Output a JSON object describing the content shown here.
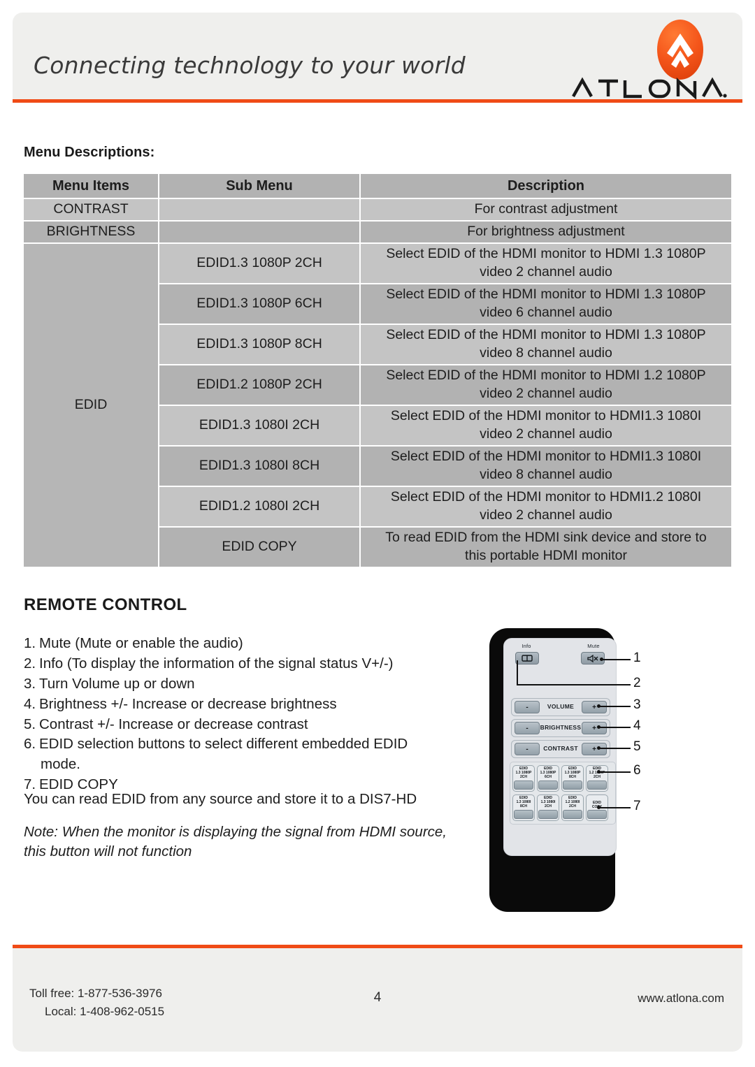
{
  "header": {
    "tagline": "Connecting technology to your world",
    "brand": "ATLONA",
    "brand_mark": "atlona-logo-icon"
  },
  "colors": {
    "accent_orange": "#f04b16",
    "panel_grey": "#efefed",
    "table_header_grey": "#b2b2b2",
    "table_row_light": "#c4c4c4",
    "table_row_dark": "#b2b2b2"
  },
  "main": {
    "section_title": "Menu Descriptions:",
    "table": {
      "headers": [
        "Menu Items",
        "Sub Menu",
        "Description"
      ],
      "rows": [
        {
          "item": "CONTRAST",
          "sub": "",
          "desc_line1": "For contrast adjustment",
          "desc_line2": ""
        },
        {
          "item": "BRIGHTNESS",
          "sub": "",
          "desc_line1": "For brightness adjustment",
          "desc_line2": ""
        }
      ],
      "edid_group_label": "EDID",
      "edid_rows": [
        {
          "sub": "EDID1.3 1080P 2CH",
          "desc_line1": "Select EDID of the HDMI monitor to HDMI 1.3 1080P",
          "desc_line2": "video 2 channel audio"
        },
        {
          "sub": "EDID1.3 1080P 6CH",
          "desc_line1": "Select EDID of the HDMI monitor to HDMI 1.3 1080P",
          "desc_line2": "video 6 channel audio"
        },
        {
          "sub": "EDID1.3 1080P 8CH",
          "desc_line1": "Select EDID of the HDMI monitor to HDMI 1.3 1080P",
          "desc_line2": "video 8 channel audio"
        },
        {
          "sub": "EDID1.2 1080P 2CH",
          "desc_line1": "Select EDID of the HDMI monitor to  HDMI 1.2 1080P",
          "desc_line2": "video 2 channel audio"
        },
        {
          "sub": "EDID1.3 1080I 2CH",
          "desc_line1": "Select EDID of the HDMI monitor to HDMI1.3 1080I",
          "desc_line2": "video 2 channel audio"
        },
        {
          "sub": "EDID1.3 1080I 8CH",
          "desc_line1": "Select EDID of the HDMI monitor to HDMI1.3 1080I",
          "desc_line2": "video 8 channel audio"
        },
        {
          "sub": "EDID1.2 1080I 2CH",
          "desc_line1": "Select EDID of the HDMI monitor to  HDMI1.2 1080I",
          "desc_line2": "video 2 channel audio"
        },
        {
          "sub": "EDID COPY",
          "desc_line1": "To read EDID from the HDMI sink device and store to",
          "desc_line2": "this portable HDMI monitor"
        }
      ]
    },
    "remote": {
      "heading": "REMOTE CONTROL",
      "steps": [
        {
          "num": "1.",
          "text": "Mute (Mute or enable the audio)"
        },
        {
          "num": "2.",
          "text": "Info (To display the information of the signal status V+/-)"
        },
        {
          "num": "3.",
          "text": "Turn Volume up or down"
        },
        {
          "num": "4.",
          "text": "Brightness +/-  Increase or decrease brightness"
        },
        {
          "num": "5.",
          "text": "Contrast +/- Increase or decrease contrast"
        },
        {
          "num": "6.",
          "text": "EDID selection buttons to select different embedded EDID",
          "cont": "mode."
        },
        {
          "num": "7.",
          "text": "EDID COPY"
        }
      ],
      "paragraph": "You can read EDID from any source and store it to a DIS7-HD",
      "note": "Note: When the monitor is displaying the signal from HDMI source, this button will not function"
    },
    "remote_art": {
      "info_label": "Info",
      "mute_label": "Mute",
      "info_icon": "split-screen-icon",
      "mute_icon": "speaker-mute-icon",
      "rows": [
        {
          "label": "VOLUME",
          "minus": "-",
          "plus": "+"
        },
        {
          "label": "BRIGHTNESS",
          "minus": "-",
          "plus": "+"
        },
        {
          "label": "CONTRAST",
          "minus": "-",
          "plus": "+"
        }
      ],
      "edid_buttons_row1": [
        {
          "l1": "EDID",
          "l2": "1.3 1080P",
          "l3": "2CH"
        },
        {
          "l1": "EDID",
          "l2": "1.3 1080P",
          "l3": "6CH"
        },
        {
          "l1": "EDID",
          "l2": "1.3 1080P",
          "l3": "8CH"
        },
        {
          "l1": "EDID",
          "l2": "1.2 1080P",
          "l3": "2CH"
        }
      ],
      "edid_buttons_row2": [
        {
          "l1": "EDID",
          "l2": "1.3 1080I",
          "l3": "8CH"
        },
        {
          "l1": "EDID",
          "l2": "1.3 1080I",
          "l3": "2CH"
        },
        {
          "l1": "EDID",
          "l2": "1.2 1080I",
          "l3": "2CH"
        }
      ],
      "edid_copy_button": {
        "l1": "EDID",
        "l2": "COPY"
      },
      "callouts": [
        "1",
        "2",
        "3",
        "4",
        "5",
        "6",
        "7"
      ]
    }
  },
  "footer": {
    "toll_free": "Toll free: 1-877-536-3976",
    "local": "Local: 1-408-962-0515",
    "page_number": "4",
    "website": "www.atlona.com"
  }
}
